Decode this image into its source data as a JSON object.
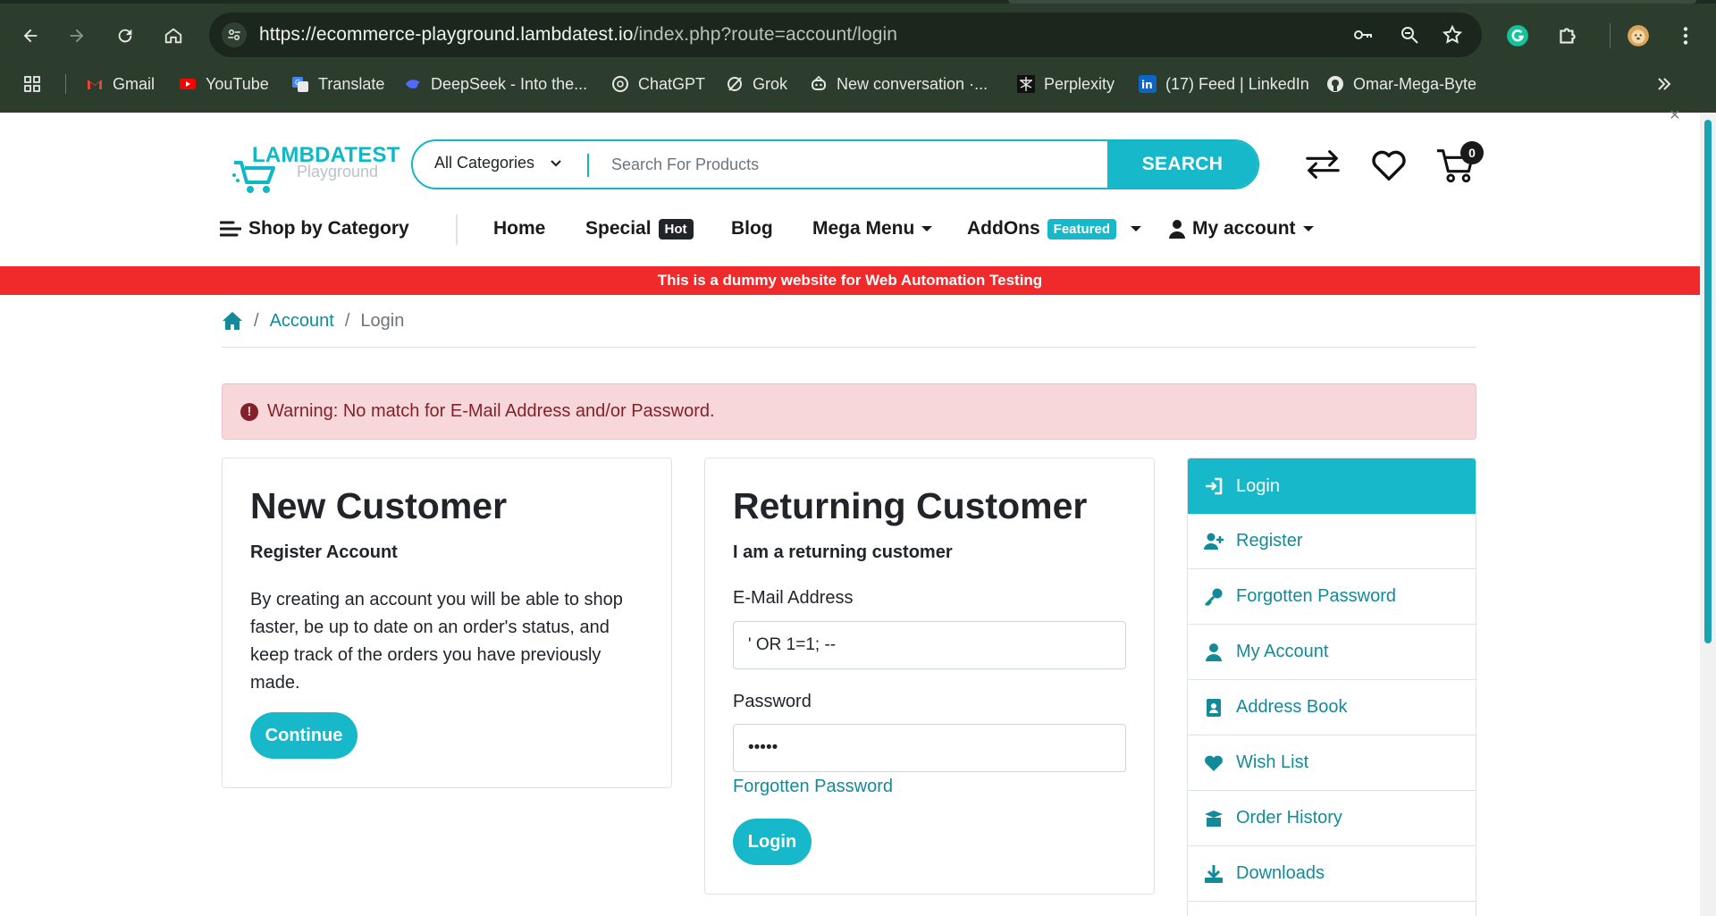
{
  "browser": {
    "url_host": "https://ecommerce-playground.lambdatest.io",
    "url_path": "/index.php?route=account/login",
    "bookmarks": [
      {
        "label": "Gmail",
        "icon": "gmail-icon"
      },
      {
        "label": "YouTube",
        "icon": "youtube-icon"
      },
      {
        "label": "Translate",
        "icon": "translate-icon"
      },
      {
        "label": "DeepSeek - Into the...",
        "icon": "deepseek-icon"
      },
      {
        "label": "ChatGPT",
        "icon": "chatgpt-icon"
      },
      {
        "label": "Grok",
        "icon": "grok-icon"
      },
      {
        "label": "New conversation ·...",
        "icon": "copilot-icon"
      },
      {
        "label": "Perplexity",
        "icon": "perplexity-icon"
      },
      {
        "label": "(17) Feed | LinkedIn",
        "icon": "linkedin-icon"
      },
      {
        "label": "Omar-Mega-Byte",
        "icon": "github-icon"
      }
    ]
  },
  "site": {
    "logo_line1": "LAMBDATEST",
    "logo_line2": "Playground",
    "search": {
      "category": "All Categories",
      "placeholder": "Search For Products",
      "button": "SEARCH"
    },
    "cart_count": "0",
    "menu": {
      "shop_by_category": "Shop by Category",
      "home": "Home",
      "special": "Special",
      "special_tag": "Hot",
      "blog": "Blog",
      "mega_menu": "Mega Menu",
      "addons": "AddOns",
      "addons_tag": "Featured",
      "my_account": "My account"
    },
    "banner": "This is a dummy website for Web Automation Testing"
  },
  "breadcrumb": {
    "account": "Account",
    "login": "Login",
    "separator": "/"
  },
  "alert": {
    "text": "Warning: No match for E-Mail Address and/or Password.",
    "icon_glyph": "!"
  },
  "new_customer": {
    "title": "New Customer",
    "subtitle": "Register Account",
    "body": "By creating an account you will be able to shop faster, be up to date on an order's status, and keep track of the orders you have previously made.",
    "button": "Continue"
  },
  "returning_customer": {
    "title": "Returning Customer",
    "subtitle": "I am a returning customer",
    "email_label": "E-Mail Address",
    "email_value": "' OR 1=1; --",
    "password_label": "Password",
    "password_value": "•••••",
    "forgotten": "Forgotten Password",
    "button": "Login"
  },
  "sidebar": {
    "items": [
      {
        "label": "Login",
        "icon": "login-icon",
        "active": true
      },
      {
        "label": "Register",
        "icon": "user-plus-icon"
      },
      {
        "label": "Forgotten Password",
        "icon": "key-icon"
      },
      {
        "label": "My Account",
        "icon": "user-icon"
      },
      {
        "label": "Address Book",
        "icon": "address-book-icon"
      },
      {
        "label": "Wish List",
        "icon": "heart-icon"
      },
      {
        "label": "Order History",
        "icon": "box-open-icon"
      },
      {
        "label": "Downloads",
        "icon": "download-icon"
      }
    ]
  },
  "colors": {
    "chrome_bg": "#2c3d2e",
    "accent": "#17b8c9",
    "link": "#138a99",
    "banner_red": "#f02a2a",
    "alert_bg": "#f8d7da",
    "alert_text": "#842029"
  }
}
